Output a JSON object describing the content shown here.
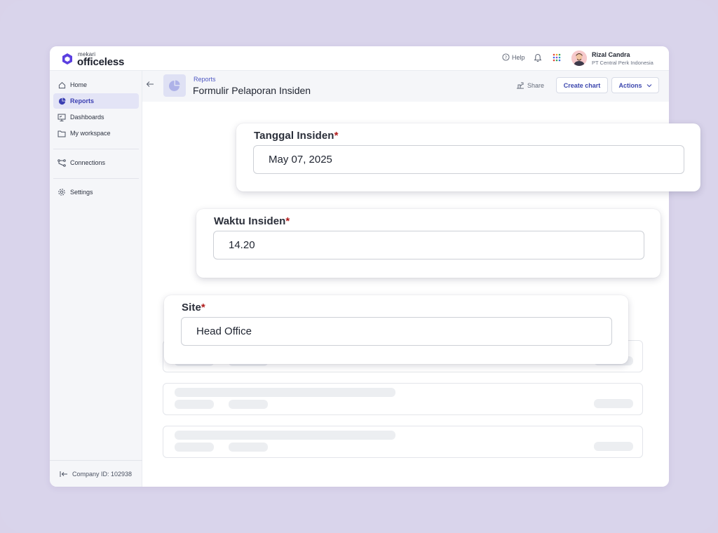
{
  "brand": {
    "small": "mekari",
    "name": "officeless"
  },
  "topbar": {
    "help_label": "Help",
    "user_name": "Rizal Candra",
    "user_org": "PT Central Perk Indonesia"
  },
  "sidebar": {
    "items": [
      {
        "label": "Home",
        "icon": "home-icon"
      },
      {
        "label": "Reports",
        "icon": "pie-chart-icon",
        "active": true
      },
      {
        "label": "Dashboards",
        "icon": "dashboard-icon"
      },
      {
        "label": "My workspace",
        "icon": "folder-icon"
      },
      {
        "label": "Connections",
        "icon": "connections-icon"
      },
      {
        "label": "Settings",
        "icon": "gear-icon"
      }
    ],
    "company_id": "Company ID: 102938"
  },
  "header": {
    "breadcrumb": "Reports",
    "title": "Formulir Pelaporan Insiden",
    "share_label": "Share",
    "create_chart_label": "Create chart",
    "actions_label": "Actions"
  },
  "fields": [
    {
      "label": "Tanggal Insiden",
      "required_mark": "*",
      "value": "May 07, 2025"
    },
    {
      "label": "Waktu Insiden",
      "required_mark": "*",
      "value": "14.20"
    },
    {
      "label": "Site",
      "required_mark": "*",
      "value": "Head Office"
    }
  ],
  "colors": {
    "accent": "#3c47ae",
    "active_bg": "#e3e4f6",
    "required": "#b01c1c",
    "page_bg": "#d9d3ea"
  }
}
